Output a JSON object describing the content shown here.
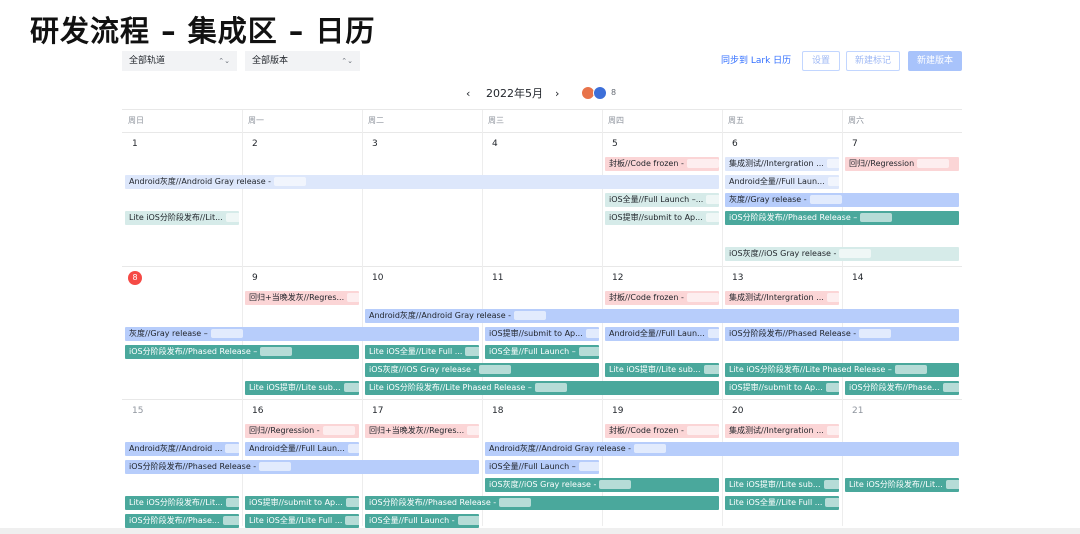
{
  "page_title": "研发流程 – 集成区 – 日历",
  "filters": {
    "track": "全部轨道",
    "version": "全部版本"
  },
  "actions": {
    "sync": "同步到 Lark 日历",
    "settings": "设置",
    "new_tag": "新建标记",
    "new_version": "新建版本"
  },
  "month": {
    "label": "2022年5月",
    "prev": "‹",
    "next": "›",
    "member_count": "8"
  },
  "weekdays": [
    "周日",
    "周一",
    "周二",
    "周三",
    "周四",
    "周五",
    "周六"
  ],
  "colors": {
    "pink": "#fbd5d6",
    "light_blue": "#dde7fb",
    "blue": "#b7cdfb",
    "teal": "#4aa89c",
    "light_teal": "#d6ebe9",
    "today": "#f54a45"
  },
  "weeks": [
    {
      "dates": [
        "1",
        "2",
        "3",
        "4",
        "5",
        "6",
        "7"
      ],
      "current": [
        true,
        true,
        true,
        true,
        true,
        true,
        true
      ],
      "events": [
        {
          "label": "封板//Code frozen -",
          "col": 4,
          "span": 1,
          "row": 0,
          "color": "pink"
        },
        {
          "label": "集成测试//Intergration ...",
          "col": 5,
          "span": 1,
          "row": 0,
          "color": "light_blue"
        },
        {
          "label": "回归//Regression",
          "col": 6,
          "span": 1,
          "row": 0,
          "color": "pink"
        },
        {
          "label": "Android灰度//Android Gray release -",
          "col": 0,
          "span": 5,
          "row": 1,
          "color": "light_blue"
        },
        {
          "label": "Android全量//Full Laun...",
          "col": 5,
          "span": 1,
          "row": 1,
          "color": "light_blue"
        },
        {
          "label": "iOS全量//Full Launch –...",
          "col": 4,
          "span": 1,
          "row": 2,
          "color": "light_teal"
        },
        {
          "label": "灰度//Gray release -",
          "col": 5,
          "span": 2,
          "row": 2,
          "color": "blue"
        },
        {
          "label": "Lite iOS分阶段发布//Lit...",
          "col": 0,
          "span": 1,
          "row": 3,
          "color": "light_teal"
        },
        {
          "label": "iOS提审//submit to Ap...",
          "col": 4,
          "span": 1,
          "row": 3,
          "color": "light_teal"
        },
        {
          "label": "iOS分阶段发布//Phased Release –",
          "col": 5,
          "span": 2,
          "row": 3,
          "color": "teal"
        },
        {
          "label": "iOS灰度//iOS Gray release -",
          "col": 5,
          "span": 2,
          "row": 5,
          "color": "light_teal"
        }
      ]
    },
    {
      "dates": [
        "8",
        "9",
        "10",
        "11",
        "12",
        "13",
        "14"
      ],
      "current": [
        true,
        true,
        true,
        true,
        true,
        true,
        true
      ],
      "events": [
        {
          "label": "回归+当晚发灰//Regres...",
          "col": 1,
          "span": 1,
          "row": 0,
          "color": "pink"
        },
        {
          "label": "封板//Code frozen -",
          "col": 4,
          "span": 1,
          "row": 0,
          "color": "pink"
        },
        {
          "label": "集成测试//Intergration ...",
          "col": 5,
          "span": 1,
          "row": 0,
          "color": "pink"
        },
        {
          "label": "Android灰度//Android Gray release -",
          "col": 2,
          "span": 5,
          "row": 1,
          "color": "blue"
        },
        {
          "label": "灰度//Gray release –",
          "col": 0,
          "span": 3,
          "row": 2,
          "color": "blue"
        },
        {
          "label": "iOS提审//submit to Ap...",
          "col": 3,
          "span": 1,
          "row": 2,
          "color": "blue"
        },
        {
          "label": "Android全量//Full Laun...",
          "col": 4,
          "span": 1,
          "row": 2,
          "color": "blue"
        },
        {
          "label": "iOS分阶段发布//Phased Release -",
          "col": 5,
          "span": 2,
          "row": 2,
          "color": "blue"
        },
        {
          "label": "iOS分阶段发布//Phased Release –",
          "col": 0,
          "span": 2,
          "row": 3,
          "color": "teal"
        },
        {
          "label": "Lite iOS全量//Lite Full ...",
          "col": 2,
          "span": 1,
          "row": 3,
          "color": "teal"
        },
        {
          "label": "iOS全量//Full Launch –",
          "col": 3,
          "span": 1,
          "row": 3,
          "color": "teal"
        },
        {
          "label": "iOS灰度//iOS Gray release -",
          "col": 2,
          "span": 2,
          "row": 4,
          "color": "teal"
        },
        {
          "label": "Lite iOS提审//Lite sub...",
          "col": 4,
          "span": 1,
          "row": 4,
          "color": "teal"
        },
        {
          "label": "Lite iOS分阶段发布//Lite Phased Release –",
          "col": 5,
          "span": 2,
          "row": 4,
          "color": "teal"
        },
        {
          "label": "Lite iOS提审//Lite sub...",
          "col": 1,
          "span": 1,
          "row": 5,
          "color": "teal"
        },
        {
          "label": "Lite iOS分阶段发布//Lite Phased Release –",
          "col": 2,
          "span": 3,
          "row": 5,
          "color": "teal"
        },
        {
          "label": "iOS提审//submit to Ap...",
          "col": 5,
          "span": 1,
          "row": 5,
          "color": "teal"
        },
        {
          "label": "iOS分阶段发布//Phase...",
          "col": 6,
          "span": 1,
          "row": 5,
          "color": "teal"
        }
      ]
    },
    {
      "dates": [
        "15",
        "16",
        "17",
        "18",
        "19",
        "20",
        "21"
      ],
      "current": [
        false,
        true,
        true,
        true,
        true,
        true,
        false
      ],
      "events": [
        {
          "label": "回归//Regression -",
          "col": 1,
          "span": 1,
          "row": 0,
          "color": "pink"
        },
        {
          "label": "回归+当晚发灰//Regres...",
          "col": 2,
          "span": 1,
          "row": 0,
          "color": "pink"
        },
        {
          "label": "封板//Code frozen -",
          "col": 4,
          "span": 1,
          "row": 0,
          "color": "pink"
        },
        {
          "label": "集成测试//Intergration ...",
          "col": 5,
          "span": 1,
          "row": 0,
          "color": "pink"
        },
        {
          "label": "Android灰度//Android ...",
          "col": 0,
          "span": 1,
          "row": 1,
          "color": "blue"
        },
        {
          "label": "Android全量//Full Laun...",
          "col": 1,
          "span": 1,
          "row": 1,
          "color": "blue"
        },
        {
          "label": "Android灰度//Android Gray release -",
          "col": 3,
          "span": 4,
          "row": 1,
          "color": "blue"
        },
        {
          "label": "iOS分阶段发布//Phased Release -",
          "col": 0,
          "span": 3,
          "row": 2,
          "color": "blue"
        },
        {
          "label": "iOS全量//Full Launch –",
          "col": 3,
          "span": 1,
          "row": 2,
          "color": "blue"
        },
        {
          "label": "iOS灰度//iOS Gray release -",
          "col": 3,
          "span": 2,
          "row": 3,
          "color": "teal"
        },
        {
          "label": "Lite iOS提审//Lite sub...",
          "col": 5,
          "span": 1,
          "row": 3,
          "color": "teal"
        },
        {
          "label": "Lite iOS分阶段发布//Lit...",
          "col": 6,
          "span": 1,
          "row": 3,
          "color": "teal"
        },
        {
          "label": "Lite iOS分阶段发布//Lit...",
          "col": 0,
          "span": 1,
          "row": 4,
          "color": "teal"
        },
        {
          "label": "iOS提审//submit to Ap...",
          "col": 1,
          "span": 1,
          "row": 4,
          "color": "teal"
        },
        {
          "label": "iOS分阶段发布//Phased Release -",
          "col": 2,
          "span": 3,
          "row": 4,
          "color": "teal"
        },
        {
          "label": "Lite iOS全量//Lite Full ...",
          "col": 5,
          "span": 1,
          "row": 4,
          "color": "teal"
        },
        {
          "label": "iOS分阶段发布//Phase...",
          "col": 0,
          "span": 1,
          "row": 5,
          "color": "teal"
        },
        {
          "label": "Lite iOS全量//Lite Full ...",
          "col": 1,
          "span": 1,
          "row": 5,
          "color": "teal"
        },
        {
          "label": "iOS全量//Full Launch -",
          "col": 2,
          "span": 1,
          "row": 5,
          "color": "teal"
        }
      ]
    }
  ]
}
